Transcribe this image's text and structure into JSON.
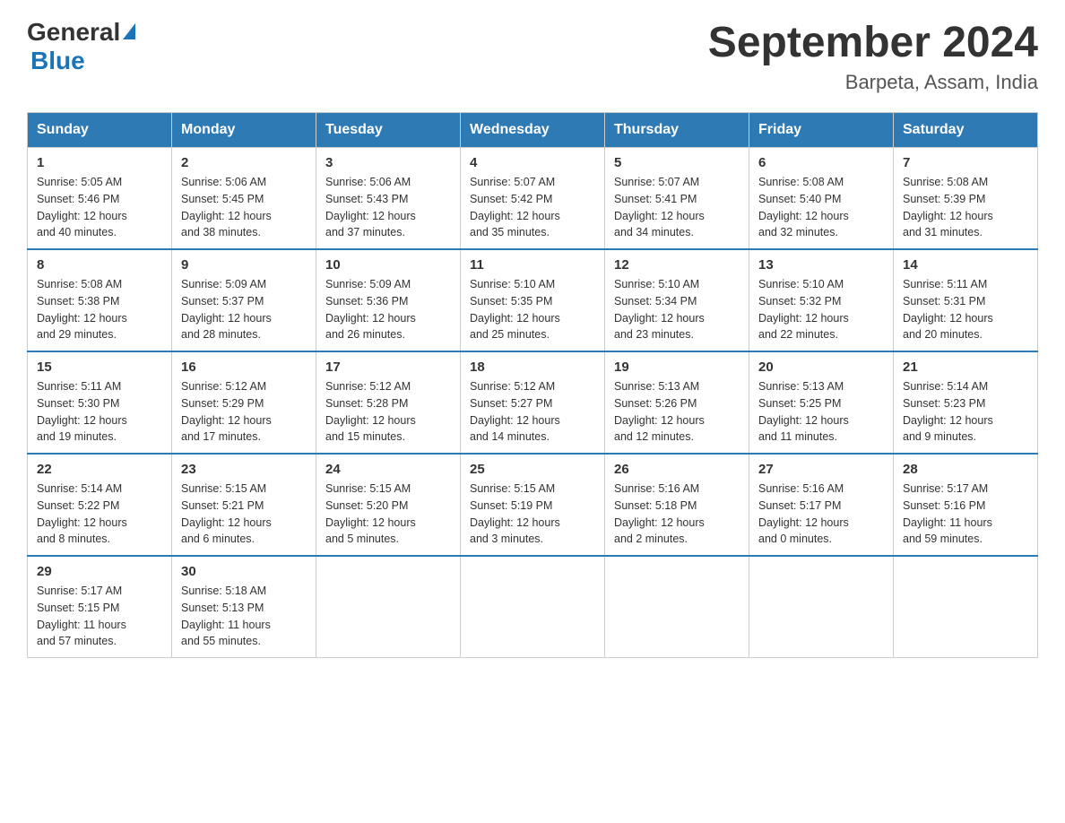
{
  "header": {
    "logo_general": "General",
    "logo_blue": "Blue",
    "month_title": "September 2024",
    "location": "Barpeta, Assam, India"
  },
  "days_of_week": [
    "Sunday",
    "Monday",
    "Tuesday",
    "Wednesday",
    "Thursday",
    "Friday",
    "Saturday"
  ],
  "weeks": [
    [
      {
        "day": "1",
        "sunrise": "5:05 AM",
        "sunset": "5:46 PM",
        "daylight": "12 hours and 40 minutes."
      },
      {
        "day": "2",
        "sunrise": "5:06 AM",
        "sunset": "5:45 PM",
        "daylight": "12 hours and 38 minutes."
      },
      {
        "day": "3",
        "sunrise": "5:06 AM",
        "sunset": "5:43 PM",
        "daylight": "12 hours and 37 minutes."
      },
      {
        "day": "4",
        "sunrise": "5:07 AM",
        "sunset": "5:42 PM",
        "daylight": "12 hours and 35 minutes."
      },
      {
        "day": "5",
        "sunrise": "5:07 AM",
        "sunset": "5:41 PM",
        "daylight": "12 hours and 34 minutes."
      },
      {
        "day": "6",
        "sunrise": "5:08 AM",
        "sunset": "5:40 PM",
        "daylight": "12 hours and 32 minutes."
      },
      {
        "day": "7",
        "sunrise": "5:08 AM",
        "sunset": "5:39 PM",
        "daylight": "12 hours and 31 minutes."
      }
    ],
    [
      {
        "day": "8",
        "sunrise": "5:08 AM",
        "sunset": "5:38 PM",
        "daylight": "12 hours and 29 minutes."
      },
      {
        "day": "9",
        "sunrise": "5:09 AM",
        "sunset": "5:37 PM",
        "daylight": "12 hours and 28 minutes."
      },
      {
        "day": "10",
        "sunrise": "5:09 AM",
        "sunset": "5:36 PM",
        "daylight": "12 hours and 26 minutes."
      },
      {
        "day": "11",
        "sunrise": "5:10 AM",
        "sunset": "5:35 PM",
        "daylight": "12 hours and 25 minutes."
      },
      {
        "day": "12",
        "sunrise": "5:10 AM",
        "sunset": "5:34 PM",
        "daylight": "12 hours and 23 minutes."
      },
      {
        "day": "13",
        "sunrise": "5:10 AM",
        "sunset": "5:32 PM",
        "daylight": "12 hours and 22 minutes."
      },
      {
        "day": "14",
        "sunrise": "5:11 AM",
        "sunset": "5:31 PM",
        "daylight": "12 hours and 20 minutes."
      }
    ],
    [
      {
        "day": "15",
        "sunrise": "5:11 AM",
        "sunset": "5:30 PM",
        "daylight": "12 hours and 19 minutes."
      },
      {
        "day": "16",
        "sunrise": "5:12 AM",
        "sunset": "5:29 PM",
        "daylight": "12 hours and 17 minutes."
      },
      {
        "day": "17",
        "sunrise": "5:12 AM",
        "sunset": "5:28 PM",
        "daylight": "12 hours and 15 minutes."
      },
      {
        "day": "18",
        "sunrise": "5:12 AM",
        "sunset": "5:27 PM",
        "daylight": "12 hours and 14 minutes."
      },
      {
        "day": "19",
        "sunrise": "5:13 AM",
        "sunset": "5:26 PM",
        "daylight": "12 hours and 12 minutes."
      },
      {
        "day": "20",
        "sunrise": "5:13 AM",
        "sunset": "5:25 PM",
        "daylight": "12 hours and 11 minutes."
      },
      {
        "day": "21",
        "sunrise": "5:14 AM",
        "sunset": "5:23 PM",
        "daylight": "12 hours and 9 minutes."
      }
    ],
    [
      {
        "day": "22",
        "sunrise": "5:14 AM",
        "sunset": "5:22 PM",
        "daylight": "12 hours and 8 minutes."
      },
      {
        "day": "23",
        "sunrise": "5:15 AM",
        "sunset": "5:21 PM",
        "daylight": "12 hours and 6 minutes."
      },
      {
        "day": "24",
        "sunrise": "5:15 AM",
        "sunset": "5:20 PM",
        "daylight": "12 hours and 5 minutes."
      },
      {
        "day": "25",
        "sunrise": "5:15 AM",
        "sunset": "5:19 PM",
        "daylight": "12 hours and 3 minutes."
      },
      {
        "day": "26",
        "sunrise": "5:16 AM",
        "sunset": "5:18 PM",
        "daylight": "12 hours and 2 minutes."
      },
      {
        "day": "27",
        "sunrise": "5:16 AM",
        "sunset": "5:17 PM",
        "daylight": "12 hours and 0 minutes."
      },
      {
        "day": "28",
        "sunrise": "5:17 AM",
        "sunset": "5:16 PM",
        "daylight": "11 hours and 59 minutes."
      }
    ],
    [
      {
        "day": "29",
        "sunrise": "5:17 AM",
        "sunset": "5:15 PM",
        "daylight": "11 hours and 57 minutes."
      },
      {
        "day": "30",
        "sunrise": "5:18 AM",
        "sunset": "5:13 PM",
        "daylight": "11 hours and 55 minutes."
      },
      null,
      null,
      null,
      null,
      null
    ]
  ]
}
